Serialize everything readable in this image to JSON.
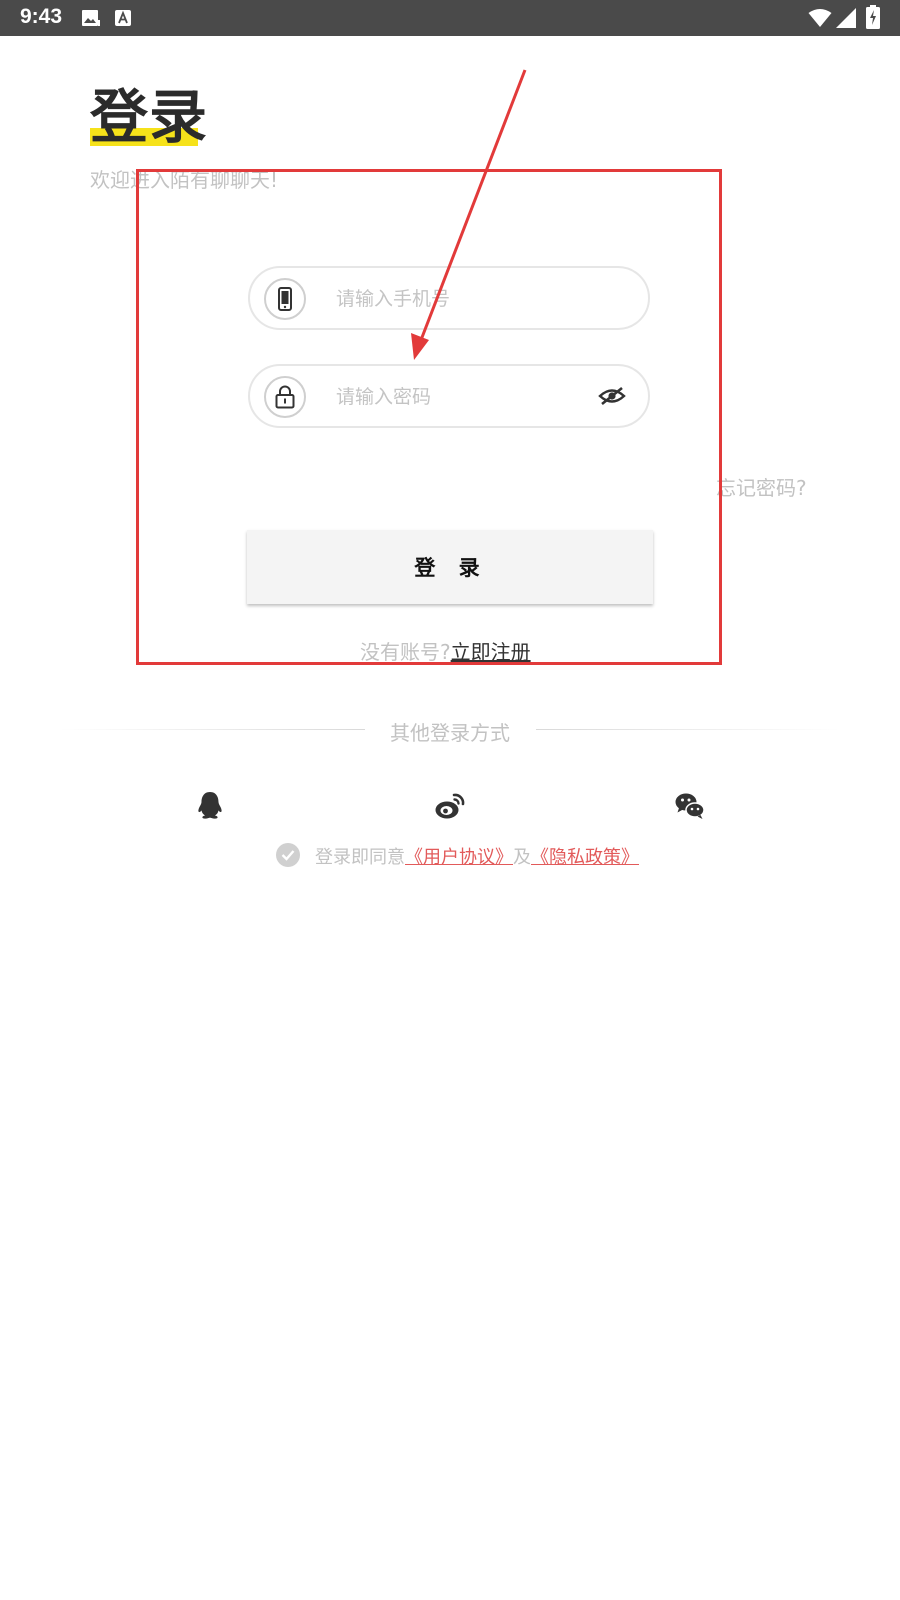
{
  "status_bar": {
    "time": "9:43",
    "icons": [
      "image-icon",
      "font-icon",
      "wifi-icon",
      "signal-icon",
      "battery-icon"
    ]
  },
  "login": {
    "title": "登录",
    "subtitle": "欢迎进入陌有聊聊天!",
    "phone_placeholder": "请输入手机号",
    "password_placeholder": "请输入密码",
    "forgot_password": "忘记密码?",
    "submit_label": "登 录",
    "no_account_text": "没有账号?",
    "register_link": "立即注册"
  },
  "other_login": {
    "label": "其他登录方式",
    "providers": [
      "qq-icon",
      "weibo-icon",
      "wechat-icon"
    ]
  },
  "agreement": {
    "prefix": "登录即同意",
    "user_agreement": "《用户协议》",
    "conjunction": "及",
    "privacy_policy": "《隐私政策》"
  },
  "colors": {
    "status_bar_bg": "#4a4a4a",
    "title_highlight": "#f6e21a",
    "link_red": "#e25a5a",
    "annotation_red": "#e23a3a"
  }
}
